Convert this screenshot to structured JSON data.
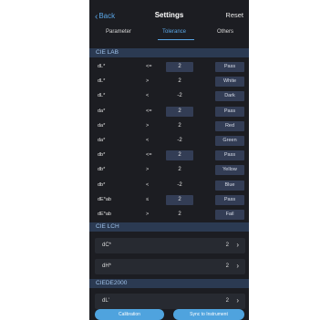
{
  "nav": {
    "back_label": "Back",
    "title": "Settings",
    "reset_label": "Reset"
  },
  "tabs": [
    {
      "label": "Parameter"
    },
    {
      "label": "Tolerance"
    },
    {
      "label": "Others"
    }
  ],
  "sections": {
    "cielab": "CIE LAB",
    "cielch": "CIE LCH",
    "ciede2000": "CIEDE2000"
  },
  "cielab_rows": [
    {
      "label": "dL*",
      "op": "<=",
      "value": "2",
      "result": "Pass"
    },
    {
      "label": "dL*",
      "op": ">",
      "value": "2",
      "result": "White"
    },
    {
      "label": "dL*",
      "op": "<",
      "value": "-2",
      "result": "Dark"
    },
    {
      "label": "da*",
      "op": "<=",
      "value": "2",
      "result": "Pass"
    },
    {
      "label": "da*",
      "op": ">",
      "value": "2",
      "result": "Red"
    },
    {
      "label": "da*",
      "op": "<",
      "value": "-2",
      "result": "Green"
    },
    {
      "label": "db*",
      "op": "<=",
      "value": "2",
      "result": "Pass"
    },
    {
      "label": "db*",
      "op": ">",
      "value": "2",
      "result": "Yellow"
    },
    {
      "label": "db*",
      "op": "<",
      "value": "-2",
      "result": "Blue"
    },
    {
      "label": "dE*ab",
      "op": "≤",
      "value": "2",
      "result": "Pass"
    },
    {
      "label": "dE*ab",
      "op": ">",
      "value": "2",
      "result": "Fail"
    }
  ],
  "cielch_rows": [
    {
      "label": "dC*",
      "value": "2"
    },
    {
      "label": "dH*",
      "value": "2"
    }
  ],
  "ciede2000_rows": [
    {
      "label": "dL'",
      "value": "2"
    }
  ],
  "bottom": {
    "calibration_label": "Calibration",
    "sync_label": "Sync to Instrument"
  },
  "colors": {
    "accent": "#4fa3de",
    "background": "#1c1d22",
    "section": "#2b3a52"
  }
}
